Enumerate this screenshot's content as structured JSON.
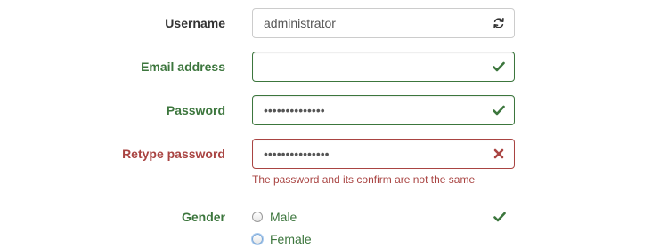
{
  "form": {
    "username": {
      "label": "Username",
      "value": "administrator",
      "icon": "refresh-icon"
    },
    "email": {
      "label": "Email address",
      "value": "",
      "state": "success",
      "icon": "check-icon"
    },
    "password": {
      "label": "Password",
      "value": "••••••••••••••",
      "state": "success",
      "icon": "check-icon"
    },
    "retype_password": {
      "label": "Retype password",
      "value": "•••••••••••••••",
      "state": "error",
      "icon": "times-icon",
      "help": "The password and its confirm are not the same"
    },
    "gender": {
      "label": "Gender",
      "options": [
        {
          "label": "Male",
          "checked": false
        },
        {
          "label": "Female",
          "checked": false
        }
      ],
      "state": "success",
      "icon": "check-icon"
    }
  },
  "colors": {
    "success": "#3c763d",
    "error": "#a94442",
    "neutral": "#333333",
    "border": "#cccccc"
  }
}
